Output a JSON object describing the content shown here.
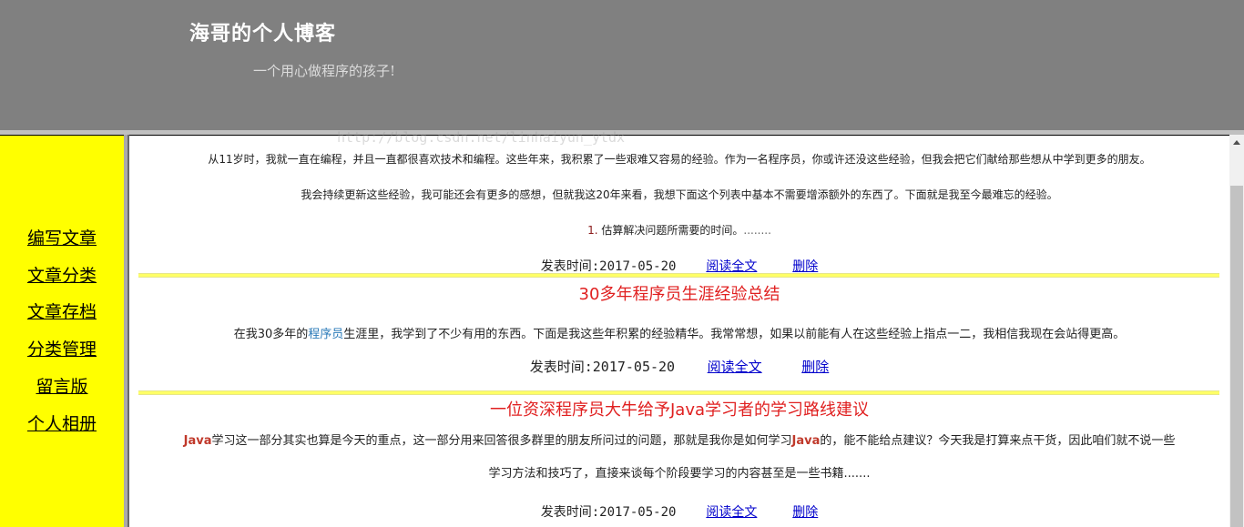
{
  "header": {
    "title": "海哥的个人博客",
    "subtitle": "一个用心做程序的孩子!"
  },
  "sidebar": {
    "items": [
      {
        "label": "编写文章"
      },
      {
        "label": "文章分类"
      },
      {
        "label": "文章存档"
      },
      {
        "label": "分类管理"
      },
      {
        "label": "留言版"
      },
      {
        "label": "个人相册"
      }
    ]
  },
  "posts": [
    {
      "paragraphs": [
        "从11岁时，我就一直在编程，并且一直都很喜欢技术和编程。这些年来，我积累了一些艰难又容易的经验。作为一名程序员，你或许还没这些经验，但我会把它们献给那些想从中学到更多的朋友。",
        "我会持续更新这些经验，我可能还会有更多的感想，但就我这20年来看，我想下面这个列表中基本不需要增添额外的东西了。下面就是我至今最难忘的经验。"
      ],
      "list_number": "1.",
      "list_text": "估算解决问题所需要的时间。",
      "list_ellipsis": "........",
      "date_label": "发表时间:2017-05-20",
      "read_label": "阅读全文",
      "delete_label": "删除"
    },
    {
      "title": "30多年程序员生涯经验总结",
      "summary_pre": "在我30多年的",
      "summary_link": "程序员",
      "summary_post": "生涯里，我学到了不少有用的东西。下面是我这些年积累的经验精华。我常常想，如果以前能有人在这些经验上指点一二，我相信我现在会站得更高。",
      "date_label": "发表时间:2017-05-20",
      "read_label": "阅读全文",
      "delete_label": "删除"
    },
    {
      "title": "一位资深程序员大牛给予Java学习者的学习路线建议",
      "summary_java1": "Java",
      "summary_a": "学习这一部分其实也算是今天的重点，这一部分用来回答很多群里的朋友所问过的问题，那就是我你是如何学习",
      "summary_java2": "Java",
      "summary_b": "的，能不能给点建议？今天我是打算来点干货，因此咱们就不说一些",
      "summary_c": "学习方法和技巧了，直接来谈每个阶段要学习的内容甚至是一些书籍.......",
      "date_label": "发表时间:2017-05-20",
      "read_label": "阅读全文",
      "delete_label": "删除"
    }
  ],
  "watermark": "http://blog.csdn.net/linhaiyun_ytdx"
}
